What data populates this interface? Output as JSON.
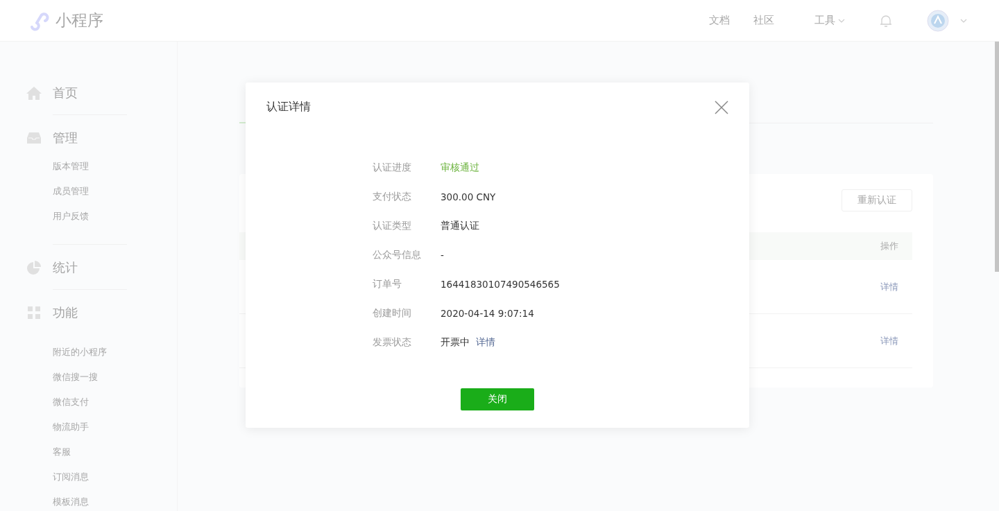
{
  "header": {
    "logo_text": "小程序",
    "nav": [
      {
        "label": "文档",
        "has_menu": false
      },
      {
        "label": "社区",
        "has_menu": false
      },
      {
        "label": "工具",
        "has_menu": true
      }
    ],
    "account_menu": true
  },
  "sidebar": [
    {
      "label": "首页"
    },
    {
      "label": "管理",
      "items": [
        "版本管理",
        "成员管理",
        "用户反馈"
      ]
    },
    {
      "label": "统计"
    },
    {
      "label": "功能",
      "items": [
        "附近的小程序",
        "微信搜一搜",
        "微信支付",
        "物流助手",
        "客服",
        "订阅消息",
        "模板消息"
      ]
    }
  ],
  "main": {
    "card": {
      "button": "重新认证",
      "table": {
        "header_last": "操作",
        "rows": [
          {
            "action": "详情"
          },
          {
            "action": "详情"
          }
        ]
      }
    }
  },
  "modal": {
    "title": "认证详情",
    "rows": [
      {
        "label": "认证进度",
        "value": "审核通过",
        "kind": "status"
      },
      {
        "label": "支付状态",
        "value": " 300.00 CNY",
        "kind": "plain"
      },
      {
        "label": "认证类型",
        "value": "普通认证",
        "kind": "plain"
      },
      {
        "label": "公众号信息",
        "value": "-",
        "kind": "plain"
      },
      {
        "label": "订单号",
        "value": "16441830107490546565",
        "kind": "plain"
      },
      {
        "label": "创建时间",
        "value": "2020-04-14 9:07:14",
        "kind": "plain"
      },
      {
        "label": "发票状态",
        "value": "开票中",
        "kind": "plain",
        "link": "详情"
      }
    ],
    "button": "关闭"
  }
}
